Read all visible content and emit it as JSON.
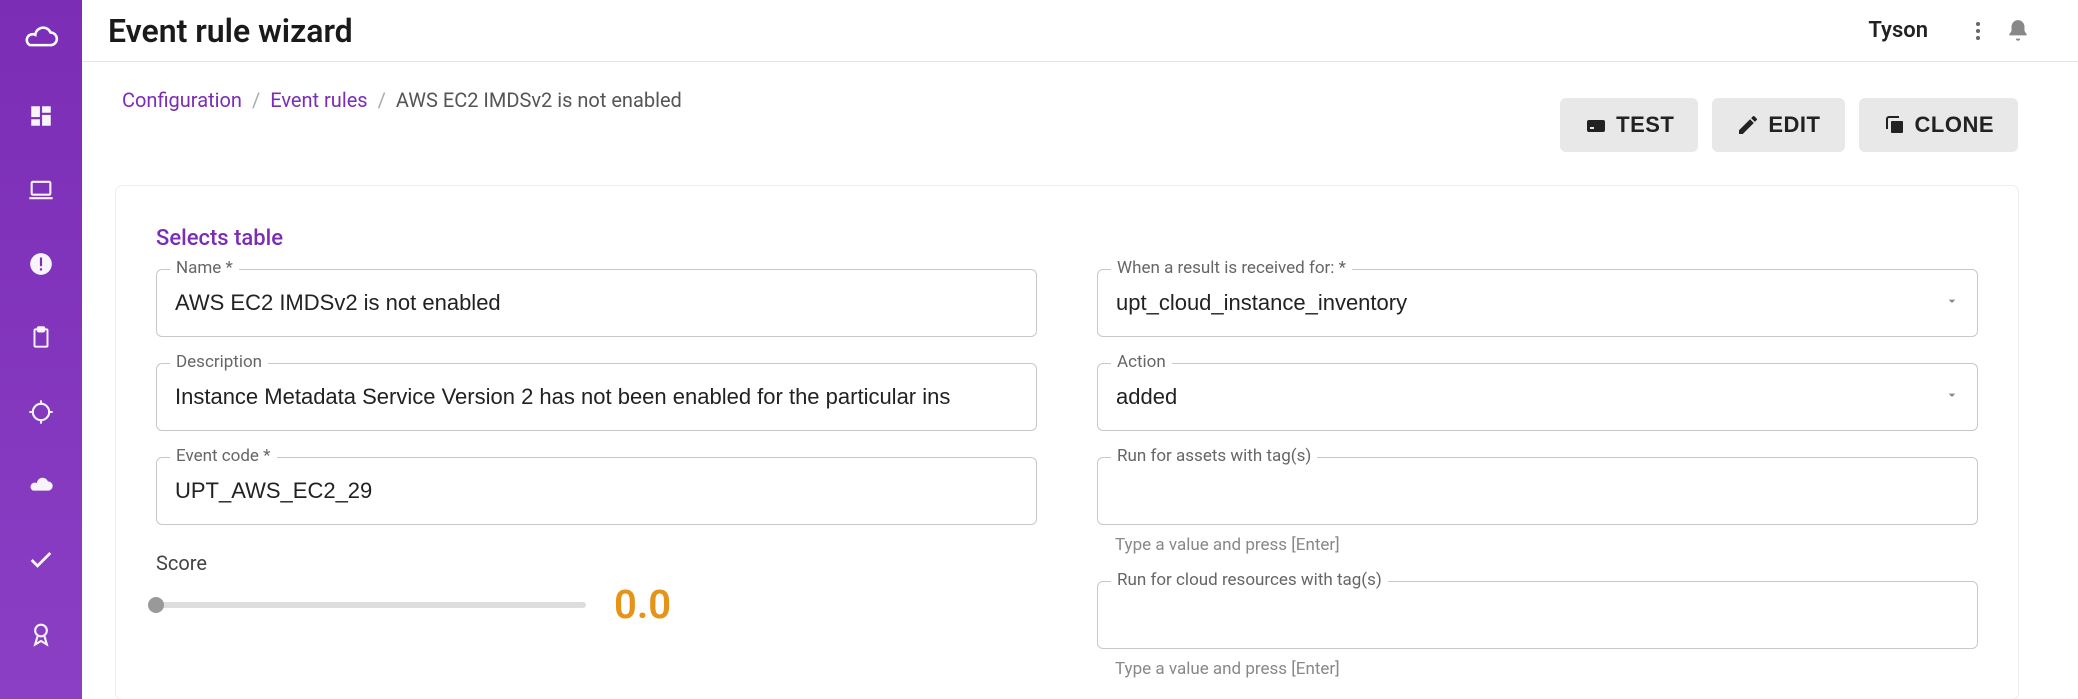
{
  "sidebar": {
    "icons": [
      "dashboard-icon",
      "laptop-icon",
      "alert-icon",
      "clipboard-icon",
      "target-icon",
      "cloud-icon",
      "check-icon",
      "award-icon"
    ]
  },
  "topbar": {
    "title": "Event rule wizard",
    "user": "Tyson"
  },
  "breadcrumb": {
    "configuration": "Configuration",
    "event_rules": "Event rules",
    "current": "AWS EC2 IMDSv2 is not enabled"
  },
  "buttons": {
    "test": "TEST",
    "edit": "EDIT",
    "clone": "CLONE"
  },
  "form": {
    "selects_table": "Selects table",
    "name_label": "Name *",
    "name_value": "AWS EC2 IMDSv2 is not enabled",
    "description_label": "Description",
    "description_value": "Instance Metadata Service Version 2 has not been enabled for the particular ins",
    "event_code_label": "Event code *",
    "event_code_value": "UPT_AWS_EC2_29",
    "score_label": "Score",
    "score_value": "0.0",
    "when_label": "When a result is received for: *",
    "when_value": "upt_cloud_instance_inventory",
    "action_label": "Action",
    "action_value": "added",
    "assets_tags_label": "Run for assets with tag(s)",
    "cloud_tags_label": "Run for cloud resources with tag(s)",
    "tag_hint": "Type a value and press [Enter]"
  }
}
